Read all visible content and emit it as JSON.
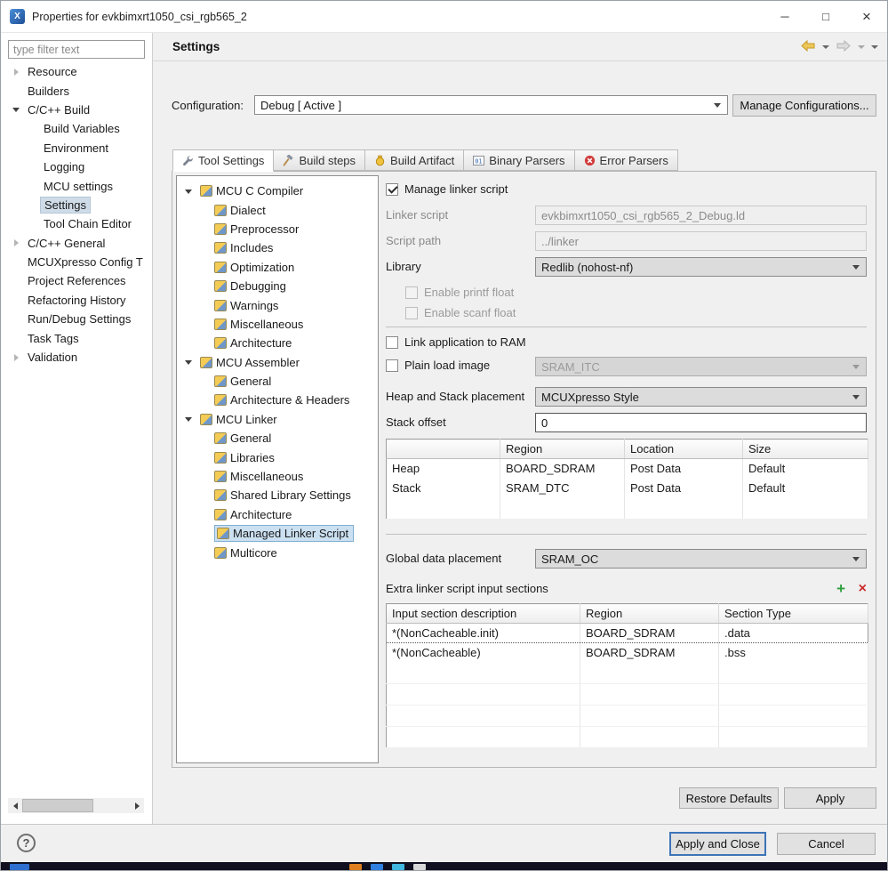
{
  "window": {
    "title": "Properties for evkbimxrt1050_csi_rgb565_2",
    "icons": {
      "minimize": "─",
      "maximize": "□",
      "close": "×"
    }
  },
  "colors": {
    "accent": "#0078d7",
    "tree_selection": "#cfdce8",
    "tool_selection": "#cbe0f1",
    "add_green": "#2e9e3e",
    "delete_red": "#cc2a2a",
    "disabled_text": "#8a8a8a"
  },
  "sidebar": {
    "filter_placeholder": "type filter text",
    "items": [
      {
        "label": "Resource",
        "state": "collapsed",
        "level": 0
      },
      {
        "label": "Builders",
        "state": "none",
        "level": 0
      },
      {
        "label": "C/C++ Build",
        "state": "expanded",
        "level": 0
      },
      {
        "label": "Build Variables",
        "state": "none",
        "level": 1
      },
      {
        "label": "Environment",
        "state": "none",
        "level": 1
      },
      {
        "label": "Logging",
        "state": "none",
        "level": 1
      },
      {
        "label": "MCU settings",
        "state": "none",
        "level": 1
      },
      {
        "label": "Settings",
        "state": "none",
        "level": 1,
        "selected": true
      },
      {
        "label": "Tool Chain Editor",
        "state": "none",
        "level": 1
      },
      {
        "label": "C/C++ General",
        "state": "collapsed",
        "level": 0
      },
      {
        "label": "MCUXpresso Config T",
        "state": "none",
        "level": 0
      },
      {
        "label": "Project References",
        "state": "none",
        "level": 0
      },
      {
        "label": "Refactoring History",
        "state": "none",
        "level": 0
      },
      {
        "label": "Run/Debug Settings",
        "state": "none",
        "level": 0
      },
      {
        "label": "Task Tags",
        "state": "none",
        "level": 0
      },
      {
        "label": "Validation",
        "state": "collapsed",
        "level": 0
      }
    ]
  },
  "header": {
    "title": "Settings"
  },
  "configuration": {
    "label": "Configuration:",
    "value": "Debug  [ Active ]",
    "manage_button": "Manage Configurations..."
  },
  "tabs": [
    {
      "label": "Tool Settings",
      "active": true
    },
    {
      "label": "Build steps",
      "active": false
    },
    {
      "label": "Build Artifact",
      "active": false
    },
    {
      "label": "Binary Parsers",
      "active": false
    },
    {
      "label": "Error Parsers",
      "active": false
    }
  ],
  "tool_tree": {
    "items": [
      {
        "label": "MCU C Compiler",
        "level": 0,
        "state": "expanded"
      },
      {
        "label": "Dialect",
        "level": 1
      },
      {
        "label": "Preprocessor",
        "level": 1
      },
      {
        "label": "Includes",
        "level": 1
      },
      {
        "label": "Optimization",
        "level": 1
      },
      {
        "label": "Debugging",
        "level": 1
      },
      {
        "label": "Warnings",
        "level": 1
      },
      {
        "label": "Miscellaneous",
        "level": 1
      },
      {
        "label": "Architecture",
        "level": 1
      },
      {
        "label": "MCU Assembler",
        "level": 0,
        "state": "expanded"
      },
      {
        "label": "General",
        "level": 1
      },
      {
        "label": "Architecture & Headers",
        "level": 1
      },
      {
        "label": "MCU Linker",
        "level": 0,
        "state": "expanded"
      },
      {
        "label": "General",
        "level": 1
      },
      {
        "label": "Libraries",
        "level": 1
      },
      {
        "label": "Miscellaneous",
        "level": 1
      },
      {
        "label": "Shared Library Settings",
        "level": 1
      },
      {
        "label": "Architecture",
        "level": 1
      },
      {
        "label": "Managed Linker Script",
        "level": 1,
        "selected": true
      },
      {
        "label": "Multicore",
        "level": 1
      }
    ]
  },
  "panel": {
    "manage": {
      "label": "Manage linker script",
      "checked": true
    },
    "linker_script": {
      "label": "Linker script",
      "value": "evkbimxrt1050_csi_rgb565_2_Debug.ld",
      "disabled": true
    },
    "script_path": {
      "label": "Script path",
      "value": "../linker",
      "disabled": true
    },
    "library": {
      "label": "Library",
      "value": "Redlib (nohost-nf)"
    },
    "printf_float": {
      "label": "Enable printf float",
      "checked": false,
      "disabled": true
    },
    "scanf_float": {
      "label": "Enable scanf float",
      "checked": false,
      "disabled": true
    },
    "link_ram": {
      "label": "Link application to RAM",
      "checked": false
    },
    "plain_load": {
      "label": "Plain load image",
      "checked": false,
      "value": "SRAM_ITC",
      "combo_disabled": true
    },
    "heap_stack": {
      "label": "Heap and Stack placement",
      "value": "MCUXpresso Style"
    },
    "stack_offset": {
      "label": "Stack offset",
      "value": "0"
    },
    "hs_table": {
      "headers": [
        "",
        "Region",
        "Location",
        "Size"
      ],
      "rows": [
        [
          "Heap",
          "BOARD_SDRAM",
          "Post Data",
          "Default"
        ],
        [
          "Stack",
          "SRAM_DTC",
          "Post Data",
          "Default"
        ]
      ]
    },
    "global_data": {
      "label": "Global data placement",
      "value": "SRAM_OC"
    },
    "extra": {
      "label": "Extra linker script input sections",
      "headers": [
        "Input section description",
        "Region",
        "Section Type"
      ],
      "rows": [
        [
          "*(NonCacheable.init)",
          "BOARD_SDRAM",
          ".data"
        ],
        [
          "*(NonCacheable)",
          "BOARD_SDRAM",
          ".bss"
        ]
      ]
    }
  },
  "footer": {
    "restore_defaults": "Restore Defaults",
    "apply": "Apply",
    "help": "?",
    "apply_and_close": "Apply and Close",
    "cancel": "Cancel"
  }
}
